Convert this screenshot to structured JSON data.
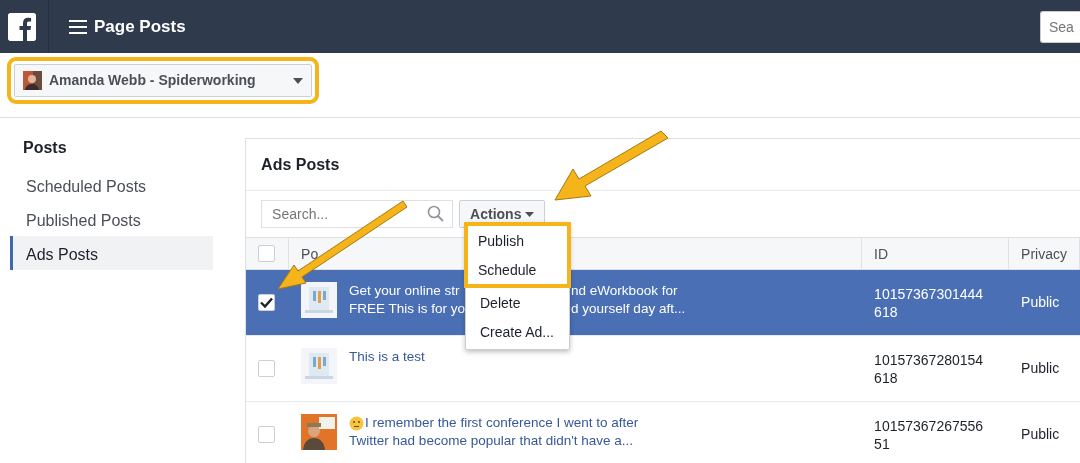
{
  "topbar": {
    "title": "Page Posts",
    "search": {
      "placeholder": "Sea"
    }
  },
  "page_selector": {
    "label": "Amanda Webb - Spiderworking",
    "highlighted": true
  },
  "sidebar": {
    "heading": "Posts",
    "items": [
      {
        "label": "Scheduled Posts",
        "selected": false
      },
      {
        "label": "Published Posts",
        "selected": false
      },
      {
        "label": "Ads Posts",
        "selected": true
      }
    ]
  },
  "panel": {
    "title": "Ads Posts",
    "search": {
      "placeholder": "Search..."
    },
    "actions_button": "Actions",
    "actions_menu": {
      "expanded": true,
      "items": [
        {
          "label": "Publish",
          "highlighted": true
        },
        {
          "label": "Schedule",
          "highlighted": true
        },
        {
          "label": "Delete",
          "highlighted": false
        },
        {
          "label": "Create Ad...",
          "highlighted": false
        }
      ]
    },
    "table": {
      "columns": [
        "Po",
        "ID",
        "Privacy"
      ],
      "select_all_checked": false,
      "rows": [
        {
          "selected": true,
          "checked": true,
          "message_lines": [
            [
              "Get your online str",
              "nd eWorkbook for"
            ],
            [
              "FREE This is for yo",
              "d yourself day aft..."
            ]
          ],
          "id_lines": [
            "10157367301444",
            "618"
          ],
          "privacy": "Public"
        },
        {
          "selected": false,
          "checked": false,
          "message_lines": [
            [
              "This is a test"
            ]
          ],
          "id_lines": [
            "10157367280154",
            "618"
          ],
          "privacy": "Public"
        },
        {
          "selected": false,
          "checked": false,
          "emoji": true,
          "message_lines": [
            [
              "I remember the first conference I went to after"
            ],
            [
              "Twitter had become popular that didn't have a..."
            ]
          ],
          "id_lines": [
            "10157367267556",
            "51"
          ],
          "privacy": "Public"
        }
      ]
    }
  }
}
